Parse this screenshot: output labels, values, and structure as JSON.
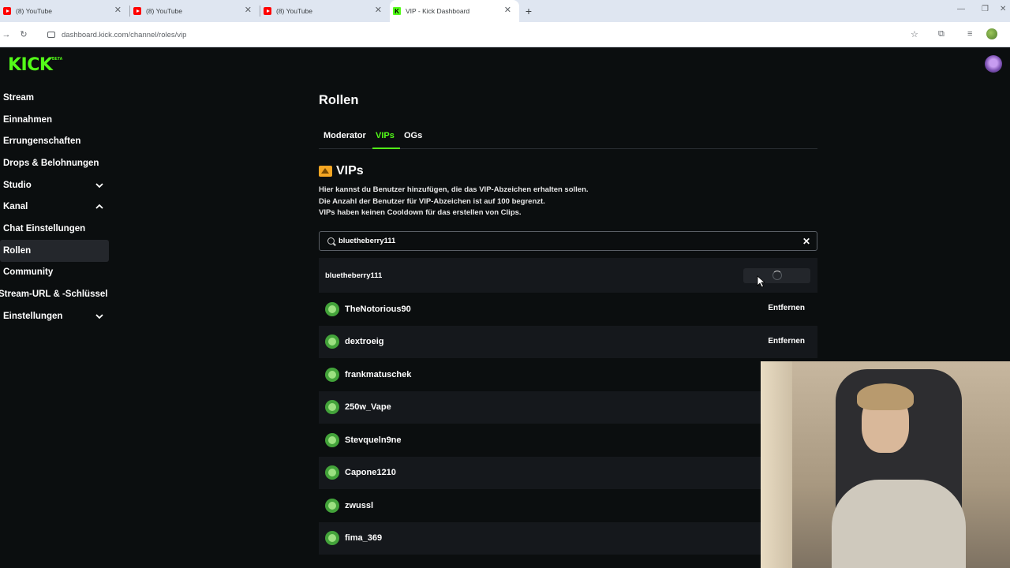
{
  "browser": {
    "tabs": [
      {
        "title": "(8) YouTube",
        "favicon": "youtube-icon"
      },
      {
        "title": "(8) YouTube",
        "favicon": "youtube-icon"
      },
      {
        "title": "(8) YouTube",
        "favicon": "youtube-icon"
      },
      {
        "title": "VIP - Kick Dashboard",
        "favicon": "kick-icon",
        "active": true
      }
    ],
    "url": "dashboard.kick.com/channel/roles/vip"
  },
  "app": {
    "logo": "KICK",
    "logo_badge": "BETA",
    "accent_color": "#53fc18"
  },
  "sidebar": {
    "items": [
      {
        "label": "Stream"
      },
      {
        "label": "Einnahmen"
      },
      {
        "label": "Errungenschaften"
      },
      {
        "label": "Drops & Belohnungen"
      },
      {
        "label": "Studio",
        "chevron": "down"
      },
      {
        "label": "Kanal",
        "chevron": "up"
      },
      {
        "label": "Chat Einstellungen"
      },
      {
        "label": "Rollen",
        "active": true
      },
      {
        "label": "Community"
      },
      {
        "label": "Stream-URL & -Schlüssel"
      },
      {
        "label": "Einstellungen",
        "chevron": "down"
      }
    ]
  },
  "main": {
    "title": "Rollen",
    "tabs": [
      {
        "label": "Moderator"
      },
      {
        "label": "VIPs",
        "active": true
      },
      {
        "label": "OGs"
      }
    ],
    "section_title": "VIPs",
    "description": [
      "Hier kannst du Benutzer hinzufügen, die das VIP-Abzeichen erhalten sollen.",
      "Die Anzahl der Benutzer für VIP-Abzeichen ist auf 100 begrenzt.",
      "VIPs haben keinen Cooldown für das erstellen von Clips."
    ],
    "search_value": "bluetheberry111",
    "search_result": "bluetheberry111",
    "remove_label": "Entfernen",
    "vips": [
      {
        "name": "TheNotorious90",
        "show_remove": true
      },
      {
        "name": "dextroeig",
        "show_remove": true
      },
      {
        "name": "frankmatuschek"
      },
      {
        "name": "250w_Vape"
      },
      {
        "name": "Stevqueln9ne"
      },
      {
        "name": "Capone1210"
      },
      {
        "name": "zwussl"
      },
      {
        "name": "fima_369"
      }
    ]
  }
}
